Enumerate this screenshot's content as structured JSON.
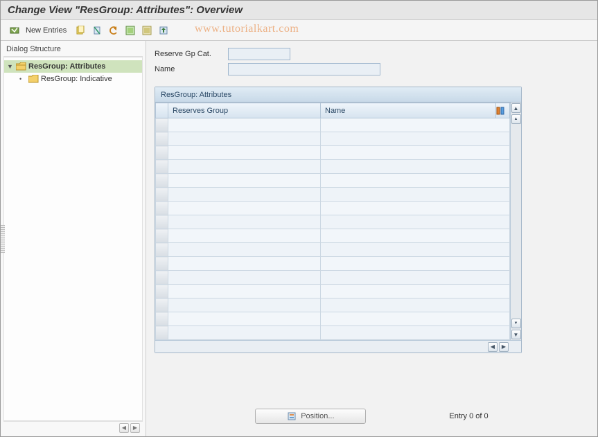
{
  "title": "Change View \"ResGroup: Attributes\": Overview",
  "watermark": "www.tutorialkart.com",
  "toolbar": {
    "new_entries": "New Entries"
  },
  "sidebar": {
    "header": "Dialog Structure",
    "items": [
      {
        "label": "ResGroup: Attributes",
        "selected": true,
        "open": true
      },
      {
        "label": "ResGroup: Indicative",
        "selected": false,
        "open": false
      }
    ]
  },
  "form": {
    "reserve_gp_cat_label": "Reserve Gp Cat.",
    "reserve_gp_cat_value": "",
    "name_label": "Name",
    "name_value": ""
  },
  "panel": {
    "title": "ResGroup: Attributes",
    "columns": {
      "c1": "Reserves Group",
      "c2": "Name"
    },
    "row_count": 16
  },
  "footer": {
    "position_label": "Position...",
    "entry_text": "Entry 0 of 0"
  }
}
